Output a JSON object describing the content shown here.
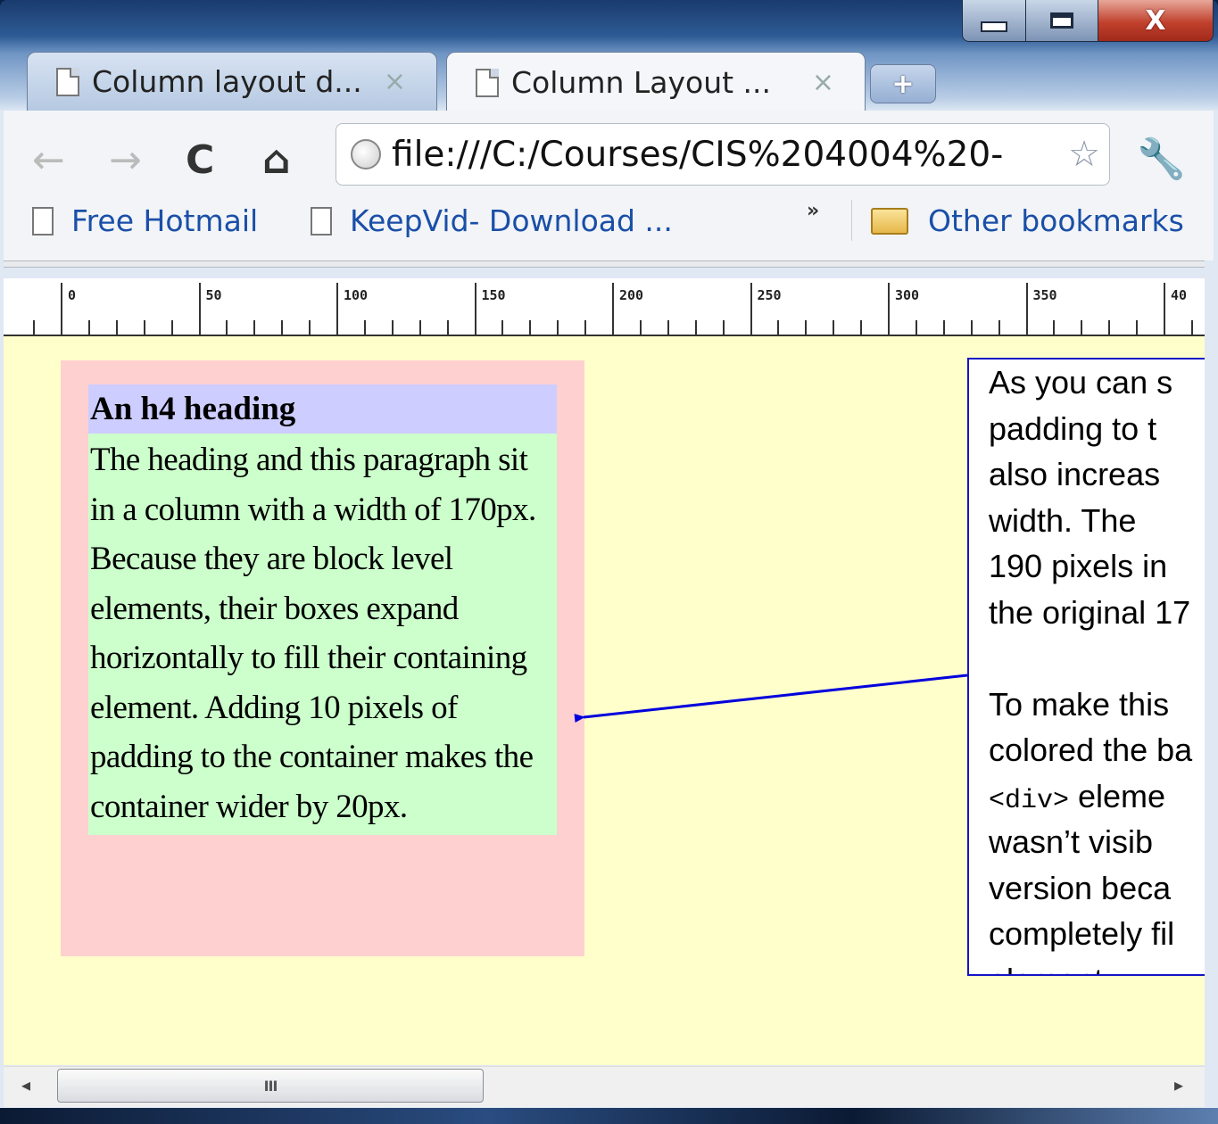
{
  "window": {
    "controls": {
      "minimize": "minimize",
      "maximize": "maximize",
      "close": "close"
    }
  },
  "tabs": [
    {
      "label": "Column layout d...",
      "close": "×"
    },
    {
      "label": "Column Layout ...",
      "close": "×"
    }
  ],
  "new_tab": "+",
  "toolbar": {
    "back": "←",
    "forward": "→",
    "reload": "C",
    "home": "⌂",
    "address": "file:///C:/Courses/CIS%204004%20-",
    "star": "☆",
    "wrench": "🔧"
  },
  "bookmarks": {
    "items": [
      {
        "label": "Free Hotmail"
      },
      {
        "label": "KeepVid- Download ..."
      }
    ],
    "overflow": "»",
    "other": "Other bookmarks"
  },
  "ruler": {
    "labels": [
      "0",
      "50",
      "100",
      "150",
      "200",
      "250",
      "300",
      "350",
      "40"
    ]
  },
  "content": {
    "heading": "An h4 heading",
    "paragraph": "The heading and this paragraph sit in a column with a width of 170px. Because they are block level elements, their boxes expand horizontally to fill their containing element. Adding 10 pixels of padding to the container makes the container wider by 20px."
  },
  "note": {
    "lines": [
      "As you can s",
      "padding to t",
      "also increas",
      "width. The",
      "190 pixels in",
      "the original 17",
      "",
      "To make this",
      "colored the ba"
    ],
    "code_tag": "<div>",
    "code_rest": " eleme",
    "lines2": [
      "wasn’t visib",
      "version beca",
      "completely fil",
      "element."
    ]
  },
  "scrollbar": {
    "grip": "III",
    "left": "◂",
    "right": "▸"
  },
  "colors": {
    "page_bg": "#ffffcc",
    "container_bg": "#ffd0d0",
    "heading_bg": "#cdcdff",
    "paragraph_bg": "#ccffcc",
    "note_border": "#1414c8",
    "arrow": "#0000dd"
  }
}
